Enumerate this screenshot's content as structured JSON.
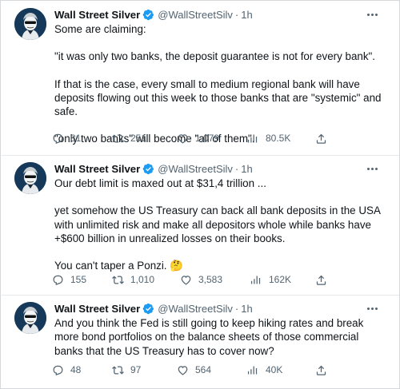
{
  "tweets": [
    {
      "author": {
        "name": "Wall Street Silver",
        "handle": "@WallStreetSilv",
        "time": "1h"
      },
      "paragraphs": [
        "Some are claiming:",
        "\"it was only two banks, the deposit guarantee is not for every bank\".",
        "If that is the case, every small to medium regional bank will have deposits flowing out this week to those banks that are \"systemic\" and safe.",
        "\"only two banks\" will become \"all of them\"."
      ],
      "stats": {
        "replies": "81",
        "retweets": "251",
        "likes": "1,079",
        "views": "80.5K"
      }
    },
    {
      "author": {
        "name": "Wall Street Silver",
        "handle": "@WallStreetSilv",
        "time": "1h"
      },
      "paragraphs": [
        "Our debt limit is maxed out at $31,4 trillion ...",
        "yet somehow the US Treasury can back all bank deposits in the USA with unlimited risk and make all depositors whole while banks have +$600 billion in unrealized losses on their books.",
        "You can't taper a Ponzi."
      ],
      "emoji": "🤔",
      "stats": {
        "replies": "155",
        "retweets": "1,010",
        "likes": "3,583",
        "views": "162K"
      }
    },
    {
      "author": {
        "name": "Wall Street Silver",
        "handle": "@WallStreetSilv",
        "time": "1h"
      },
      "paragraphs": [
        "And you think the Fed is still going to keep hiking rates and break more bond portfolios on the balance sheets of those commercial banks that the US Treasury has to cover now?"
      ],
      "stats": {
        "replies": "48",
        "retweets": "97",
        "likes": "564",
        "views": "40K"
      }
    }
  ],
  "icons": {
    "verified": "verified-badge-icon",
    "reply": "reply-icon",
    "retweet": "retweet-icon",
    "like": "like-icon",
    "views": "views-icon",
    "share": "share-icon",
    "more": "more-icon"
  },
  "colors": {
    "verified": "#1d9bf0",
    "muted": "#536471",
    "text": "#0f1419",
    "avatar_bg": "#16395a"
  }
}
